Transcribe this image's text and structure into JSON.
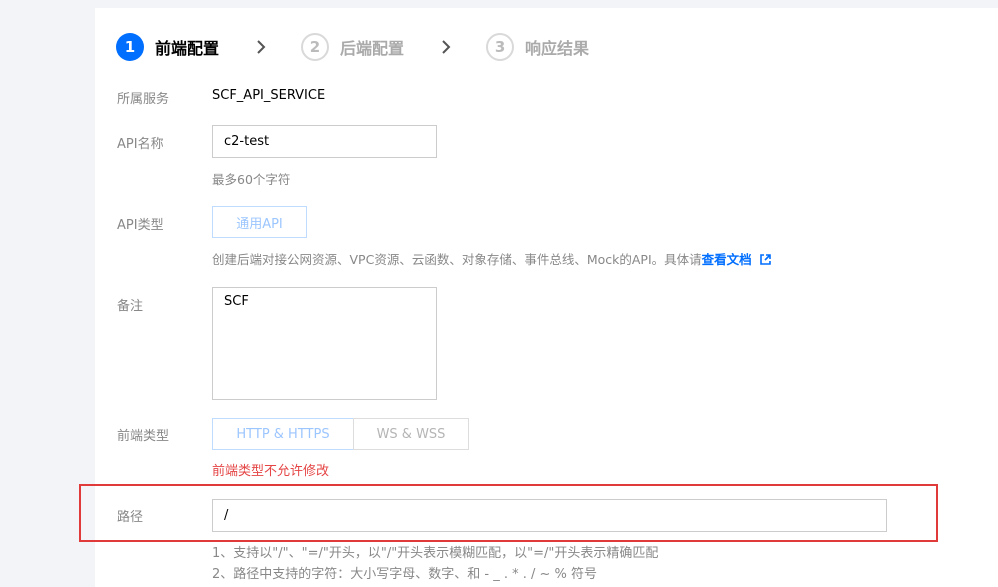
{
  "steps": [
    {
      "number": "1",
      "label": "前端配置"
    },
    {
      "number": "2",
      "label": "后端配置"
    },
    {
      "number": "3",
      "label": "响应结果"
    }
  ],
  "service": {
    "label": "所属服务",
    "value": "SCF_API_SERVICE"
  },
  "api_name": {
    "label": "API名称",
    "value": "c2-test",
    "hint": "最多60个字符"
  },
  "api_type": {
    "label": "API类型",
    "option": "通用API",
    "hint_prefix": "创建后端对接公网资源、VPC资源、云函数、对象存储、事件总线、Mock的API。具体请",
    "doc_link": "查看文档"
  },
  "remark": {
    "label": "备注",
    "value": "SCF"
  },
  "frontend_type": {
    "label": "前端类型",
    "options": [
      "HTTP & HTTPS",
      "WS & WSS"
    ],
    "selected": "HTTP & HTTPS",
    "warning": "前端类型不允许修改"
  },
  "path": {
    "label": "路径",
    "value": "/",
    "rules": [
      "1、支持以\"/\"、\"=/\"开头，以\"/\"开头表示模糊匹配，以\"=/\"开头表示精确匹配",
      "2、路径中支持的字符：大小写字母、数字、和 - _ . * . / ~ % 符号"
    ]
  },
  "colors": {
    "accent": "#006eff",
    "warning": "#e54545",
    "highlight": "#e03a3a"
  }
}
